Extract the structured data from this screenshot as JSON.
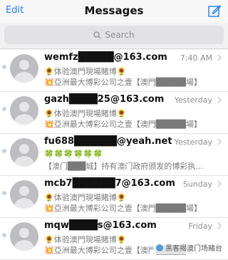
{
  "nav": {
    "edit": "Edit",
    "title": "Messages"
  },
  "search": {
    "placeholder": "Search"
  },
  "messages": [
    {
      "sender": "wemfz█████@163.com",
      "time": "7:40 AM",
      "line1": "🌻体验澳門現場賭博🌻",
      "line2": "💥亞洲最大博彩公司之壹【澳門█████場】"
    },
    {
      "sender": "gazh████25@163.com",
      "time": "Yesterday",
      "line1": "🌻体验澳門現場賭博🌻",
      "line2": "💥亞洲最大博彩公司之壹【澳門█████場】"
    },
    {
      "sender": "fu688██████@yeah.net",
      "time": "Yesterday",
      "line1": "🍀🍀🍀🍀🍀🍀",
      "line2": "【澳门███城】持有澳门政府颁发的博彩执..."
    },
    {
      "sender": "mcb7██████7@163.com",
      "time": "Sunday",
      "line1": "🌻体验澳門現場賭博🌻",
      "line2": "💥亞洲最大博彩公司之壹【澳門█████場】"
    },
    {
      "sender": "mqw████s@163.com",
      "time": "Friday",
      "line1": "🌻体验澳門現場賭博🌻",
      "line2": "💥亞洲最大博彩公司之壹【澳門█████場】"
    }
  ],
  "watermark": "黑客揭澳门场赌台",
  "colors": {
    "accent": "#1b7ef5",
    "unread_dot": "#c8d3de"
  }
}
